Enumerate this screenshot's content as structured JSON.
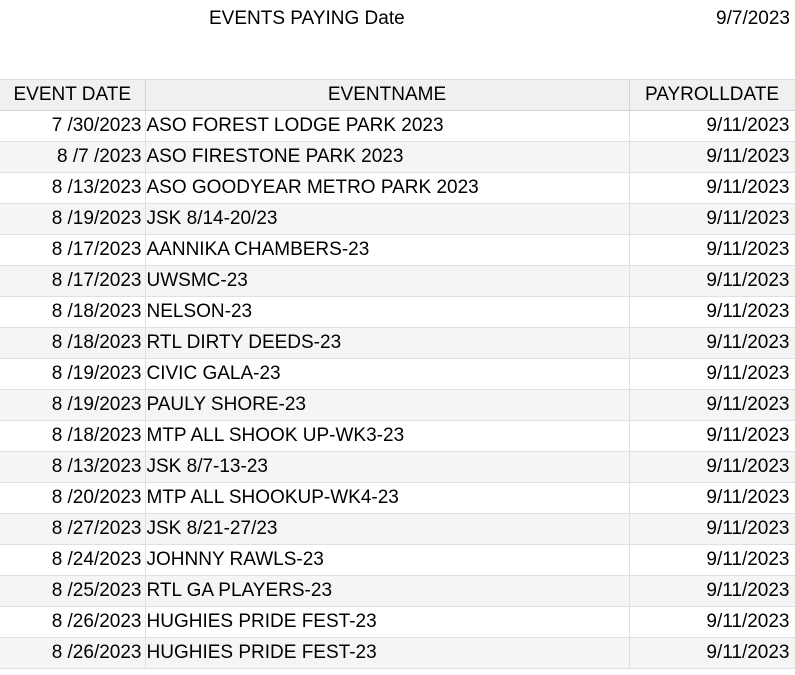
{
  "header": {
    "title": "EVENTS PAYING Date",
    "report_date": "9/7/2023"
  },
  "table": {
    "columns": [
      "EVENT DATE",
      "EVENTNAME",
      "PAYROLLDATE"
    ],
    "rows": [
      [
        "7 /30/2023",
        "ASO FOREST LODGE PARK 2023",
        "9/11/2023"
      ],
      [
        "8 /7 /2023",
        "ASO FIRESTONE PARK 2023",
        "9/11/2023"
      ],
      [
        "8 /13/2023",
        "ASO GOODYEAR METRO PARK 2023",
        "9/11/2023"
      ],
      [
        "8 /19/2023",
        "JSK 8/14-20/23",
        "9/11/2023"
      ],
      [
        "8 /17/2023",
        "AANNIKA CHAMBERS-23",
        "9/11/2023"
      ],
      [
        "8 /17/2023",
        "UWSMC-23",
        "9/11/2023"
      ],
      [
        "8 /18/2023",
        "NELSON-23",
        "9/11/2023"
      ],
      [
        "8 /18/2023",
        "RTL DIRTY DEEDS-23",
        "9/11/2023"
      ],
      [
        "8 /19/2023",
        "CIVIC GALA-23",
        "9/11/2023"
      ],
      [
        "8 /19/2023",
        "PAULY SHORE-23",
        "9/11/2023"
      ],
      [
        "8 /18/2023",
        "MTP ALL SHOOK UP-WK3-23",
        "9/11/2023"
      ],
      [
        "8 /13/2023",
        "JSK 8/7-13-23",
        "9/11/2023"
      ],
      [
        "8 /20/2023",
        "MTP ALL SHOOKUP-WK4-23",
        "9/11/2023"
      ],
      [
        "8 /27/2023",
        "JSK 8/21-27/23",
        "9/11/2023"
      ],
      [
        "8 /24/2023",
        "JOHNNY RAWLS-23",
        "9/11/2023"
      ],
      [
        "8 /25/2023",
        "RTL GA PLAYERS-23",
        "9/11/2023"
      ],
      [
        "8 /26/2023",
        "HUGHIES PRIDE FEST-23",
        "9/11/2023"
      ],
      [
        "8 /26/2023",
        "HUGHIES PRIDE FEST-23",
        "9/11/2023"
      ]
    ]
  }
}
